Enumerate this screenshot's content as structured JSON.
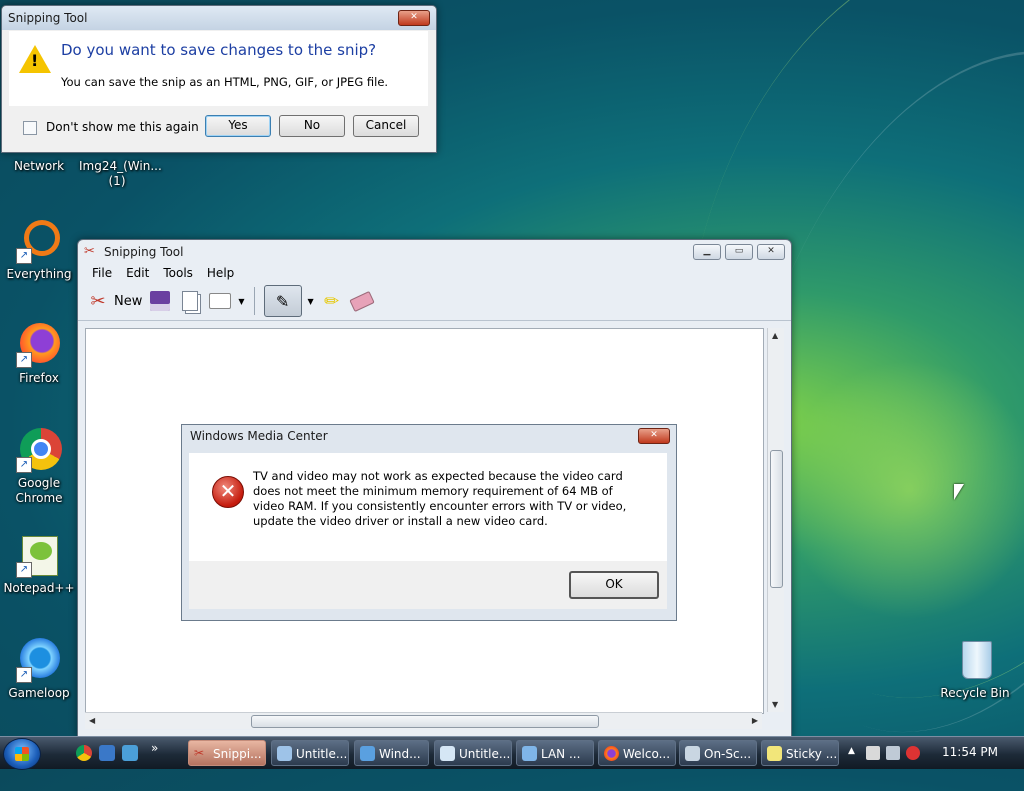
{
  "desktop": {
    "icons": [
      {
        "label": "Network"
      },
      {
        "label": "Img24_(Win... (1)"
      },
      {
        "label": "Everything"
      },
      {
        "label": "Firefox"
      },
      {
        "label": "Google Chrome"
      },
      {
        "label": "Notepad++"
      },
      {
        "label": "Gameloop"
      },
      {
        "label": "Recycle Bin"
      }
    ]
  },
  "save_dialog": {
    "title": "Snipping Tool",
    "question": "Do you want to save changes to the snip?",
    "subtext": "You can save the snip as an HTML, PNG, GIF, or JPEG file.",
    "checkbox_label": "Don't show me this again",
    "yes": "Yes",
    "no": "No",
    "cancel": "Cancel"
  },
  "snipping_tool": {
    "title": "Snipping Tool",
    "menu": [
      "File",
      "Edit",
      "Tools",
      "Help"
    ],
    "new_label": "New"
  },
  "wmc_dialog": {
    "title": "Windows Media Center",
    "message": "TV and video may not work as expected because the video card does not meet the minimum memory requirement of 64 MB of video RAM. If you consistently encounter errors with TV or video, update the video driver or install a new video card.",
    "ok": "OK"
  },
  "taskbar": {
    "items": [
      {
        "label": "Snippi..."
      },
      {
        "label": "Untitle..."
      },
      {
        "label": "Wind..."
      },
      {
        "label": "Untitle..."
      },
      {
        "label": "LAN ..."
      },
      {
        "label": "Welco..."
      },
      {
        "label": "On-Sc..."
      },
      {
        "label": "Sticky ..."
      }
    ],
    "overflow": "»",
    "clock": "11:54 PM"
  },
  "colors": {
    "accent_question": "#1d3fa3",
    "error_red": "#c41a0c",
    "warning_yellow": "#f5c400"
  }
}
